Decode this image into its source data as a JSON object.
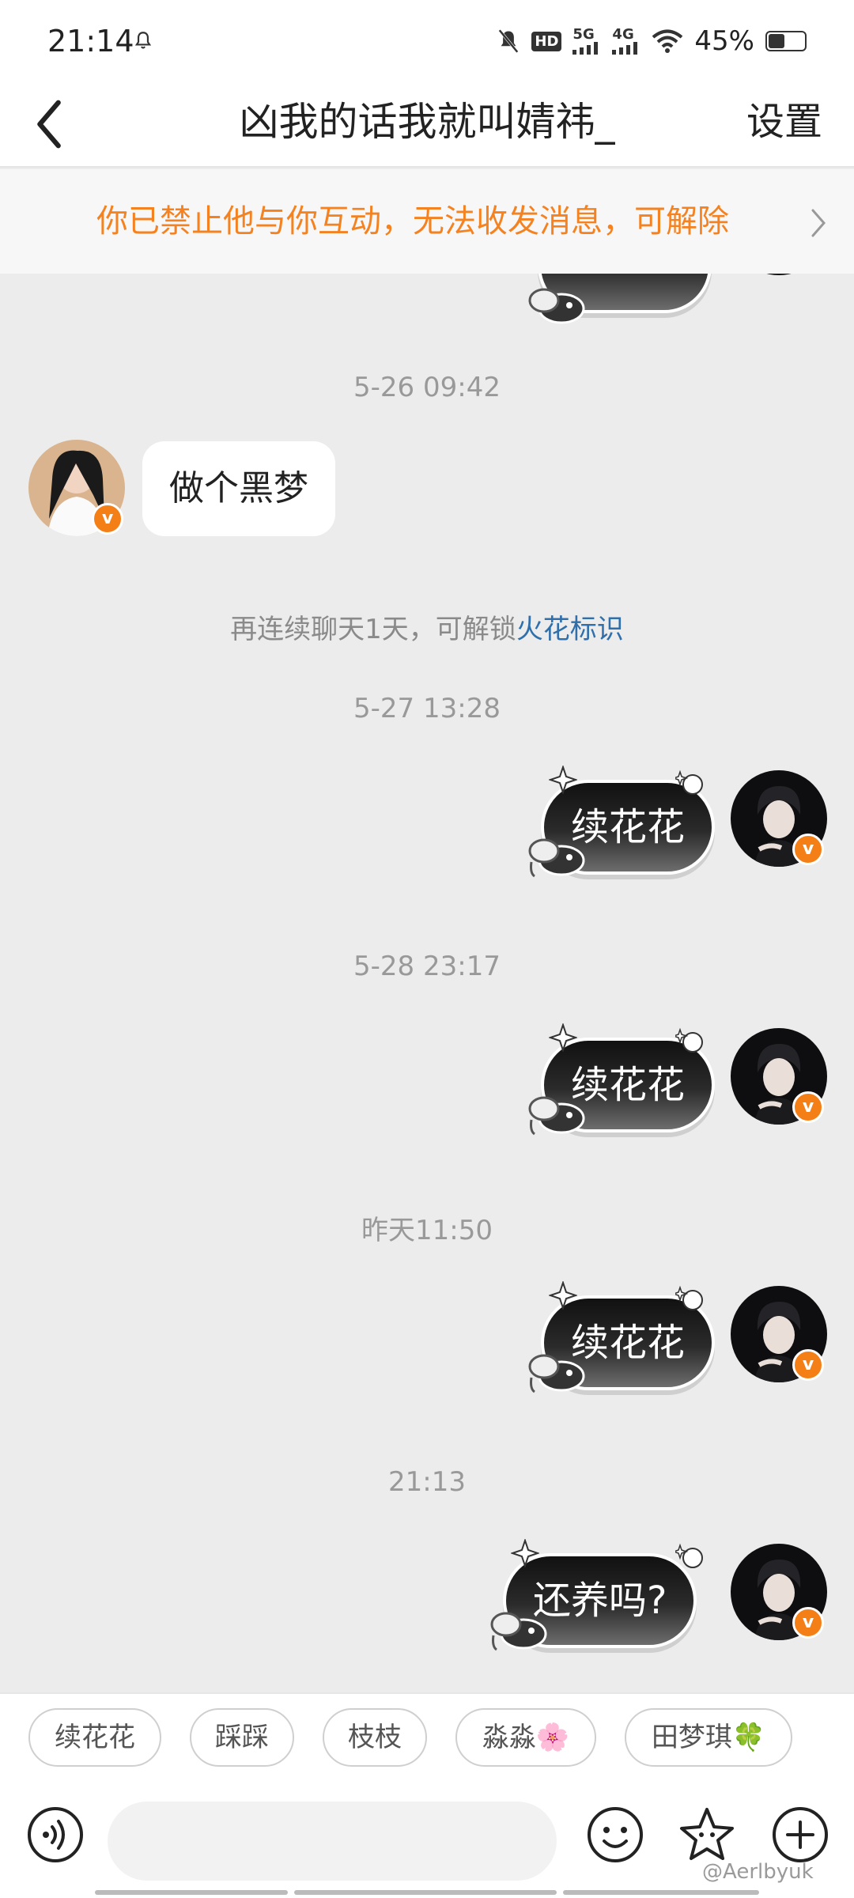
{
  "status_bar": {
    "time": "21:14",
    "network_labels": [
      "HD",
      "5G",
      "4G"
    ],
    "battery_percent_text": "45%",
    "battery_level": 0.45,
    "icons": [
      "bell-icon",
      "mute-icon",
      "hd-icon",
      "signal-icon",
      "wifi-icon",
      "battery-icon"
    ]
  },
  "header": {
    "back_icon": "chevron-left-icon",
    "title": "凶我的话我就叫婧祎_",
    "settings_label": "设置"
  },
  "banner": {
    "text": "你已禁止他与你互动，无法收发消息，可解除",
    "arrow_icon": "chevron-right-icon",
    "color": "#f58220"
  },
  "messages": [
    {
      "type": "timestamp",
      "text": "5-26 09:42"
    },
    {
      "type": "incoming",
      "text": "做个黑梦"
    },
    {
      "type": "notice",
      "text": "再连续聊天1天，可解锁",
      "link": "火花标识"
    },
    {
      "type": "timestamp",
      "text": "5-27 13:28"
    },
    {
      "type": "outgoing",
      "text": "续花花"
    },
    {
      "type": "timestamp",
      "text": "5-28 23:17"
    },
    {
      "type": "outgoing",
      "text": "续花花"
    },
    {
      "type": "timestamp",
      "text": "昨天11:50"
    },
    {
      "type": "outgoing",
      "text": "续花花"
    },
    {
      "type": "timestamp",
      "text": "21:13"
    },
    {
      "type": "outgoing",
      "text": "还养吗?"
    }
  ],
  "quick_replies": [
    "续花花",
    "踩踩",
    "枝枝",
    "淼淼🌸",
    "田梦琪🍀"
  ],
  "input_bar": {
    "icons": [
      "voice-icon",
      "emoji-icon",
      "sticker-icon",
      "plus-icon"
    ],
    "placeholder": ""
  },
  "watermark": "@Aerlbyuk",
  "colors": {
    "accent_orange": "#f57f17",
    "link_blue": "#2f6fab",
    "chat_background": "#ececec"
  }
}
